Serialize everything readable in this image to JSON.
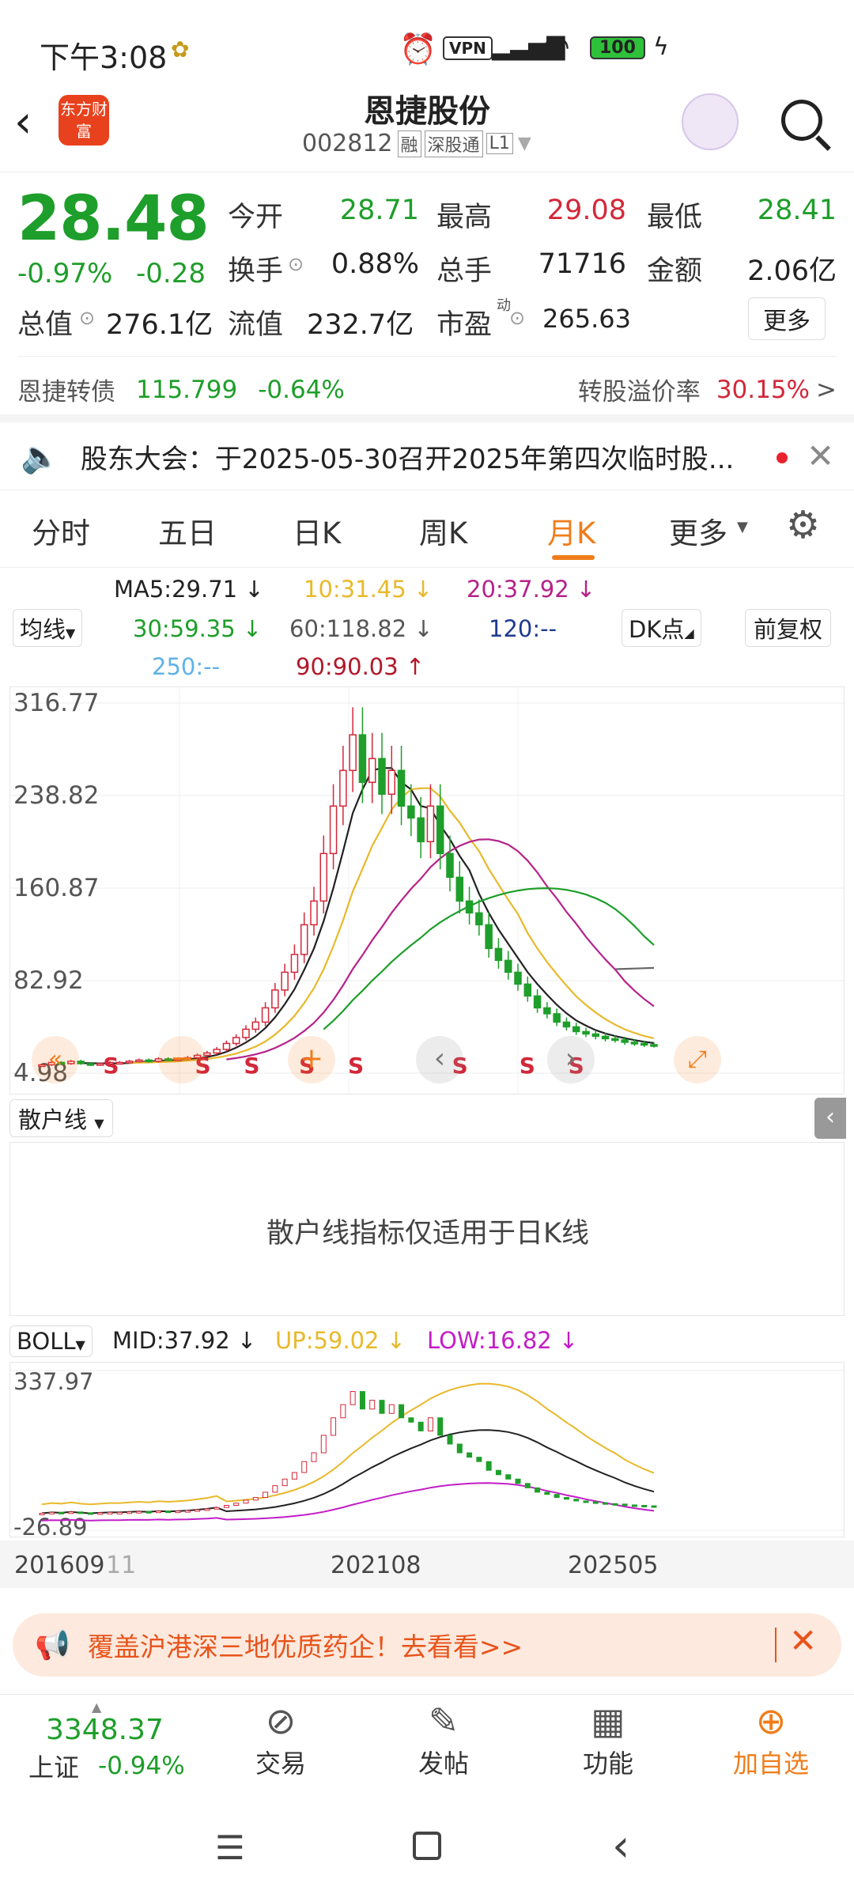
{
  "status": {
    "time": "下午3:08",
    "vpn": "VPN",
    "battery": "100"
  },
  "header": {
    "title": "恩捷股份",
    "code": "002812",
    "badges": [
      "融",
      "深股通",
      "L1"
    ],
    "logo_text": "东方财富"
  },
  "quote": {
    "price": "28.48",
    "change_pct": "-0.97%",
    "change": "-0.28",
    "open_label": "今开",
    "open": "28.71",
    "high_label": "最高",
    "high": "29.08",
    "low_label": "最低",
    "low": "28.41",
    "turnover_label": "换手",
    "turnover": "0.88%",
    "volume_label": "总手",
    "volume": "71716",
    "amount_label": "金额",
    "amount": "2.06亿",
    "mktcap_label": "总值",
    "mktcap": "276.1亿",
    "float_label": "流值",
    "float": "232.7亿",
    "pe_label": "市盈",
    "pe_sup": "动",
    "pe": "265.63",
    "more": "更多"
  },
  "bond": {
    "name": "恩捷转债",
    "price": "115.799",
    "change": "-0.64%",
    "premium_label": "转股溢价率",
    "premium": "30.15%",
    "arrow": ">"
  },
  "notice": {
    "text": "股东大会：于2025-05-30召开2025年第四次临时股..."
  },
  "tabs": [
    "分时",
    "五日",
    "日K",
    "周K",
    "月K",
    "更多"
  ],
  "active_tab": "月K",
  "ma": {
    "selector": "均线",
    "dk": "DK点",
    "adj": "前复权",
    "ma5": "MA5:29.71 ↓",
    "ma10": "10:31.45 ↓",
    "ma20": "20:37.92 ↓",
    "ma30": "30:59.35 ↓",
    "ma60": "60:118.82 ↓",
    "ma120": "120:--",
    "ma250": "250:--",
    "ma90": "90:90.03 ↑"
  },
  "chart_data": [
    {
      "type": "candlestick",
      "title": "",
      "y_ticks": [
        "316.77",
        "238.82",
        "160.87",
        "82.92",
        "4.98"
      ],
      "ylim": [
        4.98,
        316.77
      ],
      "x": [
        "201609",
        "202108",
        "202505"
      ],
      "x_extra": "11",
      "marker": "S",
      "close": [
        12,
        14,
        13,
        15,
        13,
        12,
        13,
        14,
        14,
        15,
        16,
        15,
        17,
        16,
        17,
        18,
        20,
        22,
        25,
        30,
        35,
        42,
        48,
        60,
        75,
        90,
        105,
        130,
        150,
        190,
        230,
        260,
        290,
        250,
        270,
        240,
        260,
        230,
        220,
        200,
        230,
        190,
        170,
        150,
        140,
        130,
        110,
        100,
        90,
        80,
        70,
        60,
        55,
        48,
        44,
        40,
        38,
        36,
        34,
        33,
        31,
        30,
        29,
        28.5
      ]
    },
    {
      "type": "line",
      "title": "BOLL",
      "series": [
        {
          "name": "MID",
          "label": "MID:37.92 ↓"
        },
        {
          "name": "UP",
          "label": "UP:59.02 ↓"
        },
        {
          "name": "LOW",
          "label": "LOW:16.82 ↓"
        }
      ],
      "y_ticks": [
        "337.97",
        "-26.89"
      ],
      "ylim": [
        -26.89,
        337.97
      ],
      "x": [
        "201609",
        "202108",
        "202505"
      ]
    }
  ],
  "indicator": {
    "selector": "散户线",
    "message": "散户线指标仅适用于日K线",
    "boll_selector": "BOLL"
  },
  "ad": {
    "text": "覆盖沪港深三地优质药企！去看看>>"
  },
  "nav": {
    "index_value": "3348.37",
    "index_name": "上证",
    "index_change": "-0.94%",
    "trade": "交易",
    "post": "发帖",
    "func": "功能",
    "add": "加自选"
  },
  "colors": {
    "green": "#1e9e2a",
    "red": "#d2283a",
    "accent": "#f07d1b"
  }
}
